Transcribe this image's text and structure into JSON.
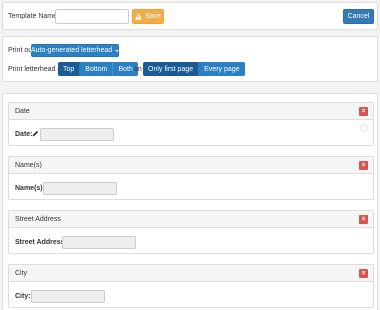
{
  "header": {
    "template_name_label": "Template Name",
    "required_marker": "*",
    "template_name_value": "",
    "save_label": "Save",
    "save_icon": "warning-icon",
    "cancel_label": "Cancel"
  },
  "print": {
    "print_out_label": "Print out",
    "letterhead_dropdown": "Auto-generated letterhead",
    "print_letterhead_on_label": "Print letterhead on",
    "position_options": [
      "Top",
      "Bottom",
      "Both"
    ],
    "on_label": "on",
    "page_options": [
      "Only first page",
      "Every page"
    ]
  },
  "fields": [
    {
      "title": "Date",
      "label": "Date:",
      "editable_icon": "pencil-icon",
      "value": ""
    },
    {
      "title": "Name(s)",
      "label": "Name(s):",
      "value": ""
    },
    {
      "title": "Street Address",
      "label": "Street Address:",
      "value": ""
    },
    {
      "title": "City",
      "label": "City:",
      "value": ""
    }
  ],
  "remove_icon": "close-icon",
  "colors": {
    "save": "#f0ad4e",
    "primary": "#337ab7",
    "segment": "#2b7fc3",
    "segment_active": "#1a5a95",
    "remove": "#d9534f"
  }
}
